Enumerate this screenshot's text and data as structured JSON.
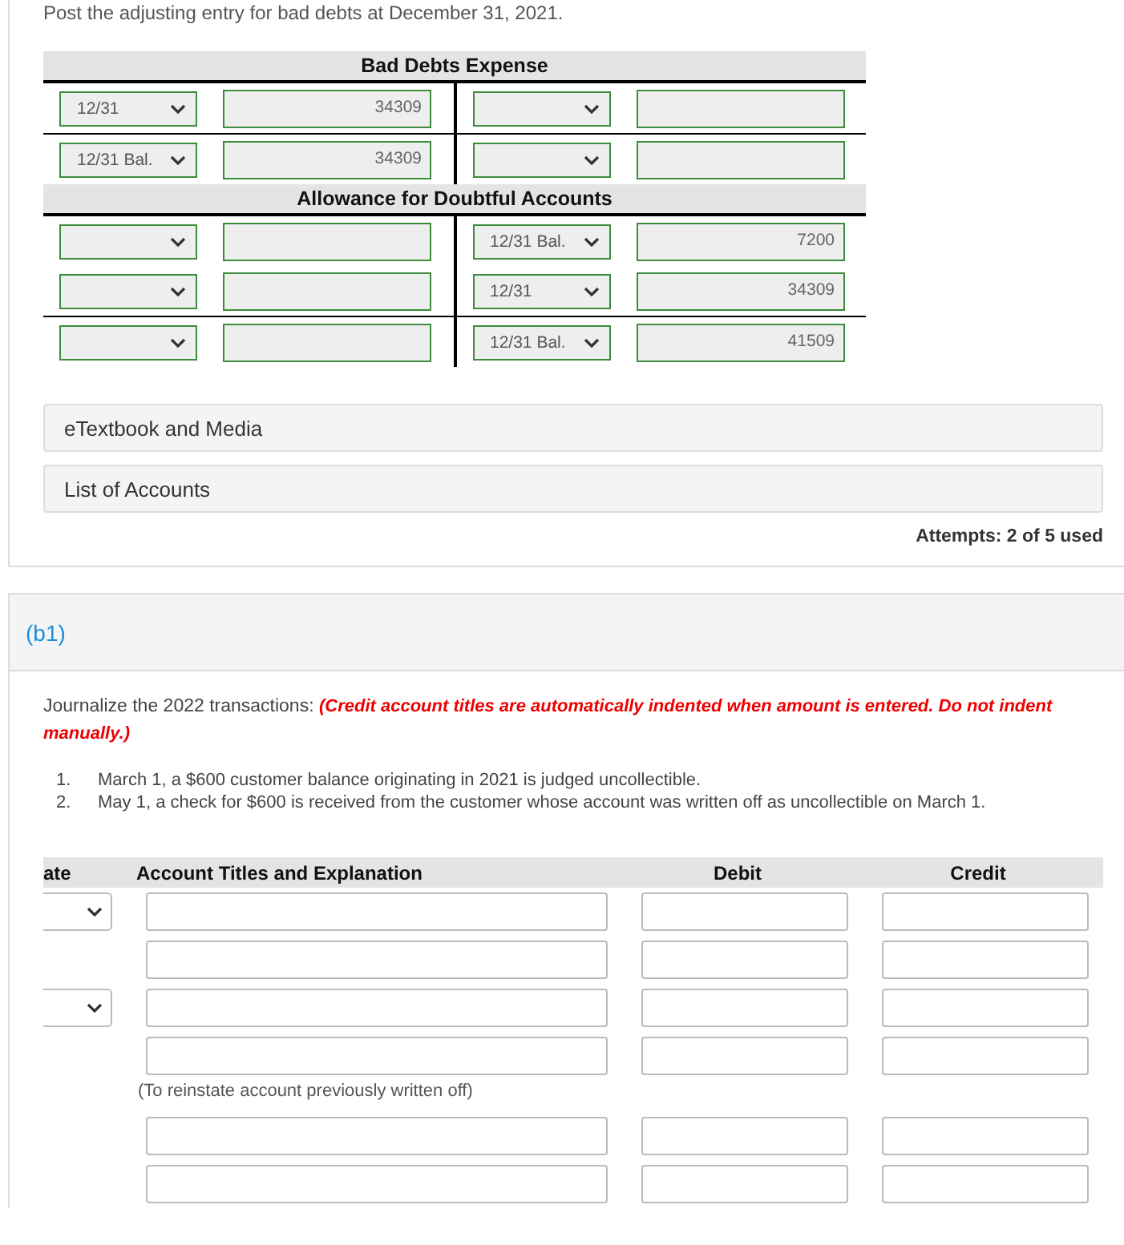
{
  "instruction": "Post the adjusting entry for bad debts at December 31, 2021.",
  "t_accounts": [
    {
      "title": "Bad Debts Expense",
      "correct": true,
      "rows": [
        {
          "debit_date": "12/31",
          "debit_amount": "34309",
          "total_line": false
        },
        {
          "debit_date": "12/31 Bal.",
          "debit_amount": "34309",
          "total_line": true
        }
      ]
    },
    {
      "title": "Allowance for Doubtful Accounts",
      "correct": true,
      "rows": [
        {
          "credit_date": "12/31 Bal.",
          "credit_amount": "7200",
          "total_line": false
        },
        {
          "credit_date": "12/31",
          "credit_amount": "34309",
          "total_line": false
        },
        {
          "credit_date": "12/31 Bal.",
          "credit_amount": "41509",
          "total_line": true
        }
      ]
    }
  ],
  "resources": [
    "eTextbook and Media",
    "List of Accounts"
  ],
  "attempts": "Attempts: 2 of 5 used",
  "part": {
    "label": "(b1)",
    "prompt": "Journalize the 2022 transactions: ",
    "warning": "(Credit account titles are automatically indented when amount is entered. Do not indent manually.)",
    "transactions": [
      {
        "number": "1.",
        "text": "March 1, a $600 customer balance originating in 2021 is judged uncollectible."
      },
      {
        "number": "2.",
        "text": "May 1, a check for $600 is received from the customer whose account was written off as uncollectible on March 1."
      }
    ],
    "journal": {
      "columns": [
        "ate",
        "Account Titles and Explanation",
        "Debit",
        "Credit"
      ],
      "rows": [
        {
          "kind": "dated"
        },
        {
          "kind": "line"
        },
        {
          "kind": "dated"
        },
        {
          "kind": "line"
        },
        {
          "kind": "note",
          "text": "(To reinstate account previously written off)"
        },
        {
          "kind": "line"
        },
        {
          "kind": "line"
        }
      ]
    }
  }
}
